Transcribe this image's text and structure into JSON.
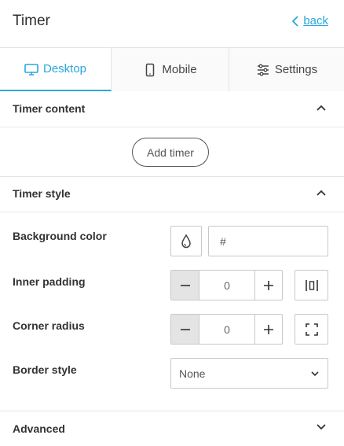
{
  "header": {
    "title": "Timer",
    "back_label": "back"
  },
  "tabs": [
    {
      "label": "Desktop",
      "icon": "desktop-icon",
      "active": true
    },
    {
      "label": "Mobile",
      "icon": "mobile-icon",
      "active": false
    },
    {
      "label": "Settings",
      "icon": "sliders-icon",
      "active": false
    }
  ],
  "timer_content": {
    "label": "Timer content",
    "add_button": "Add timer"
  },
  "timer_style": {
    "label": "Timer style",
    "background_color": {
      "label": "Background color",
      "placeholder": "#",
      "icon": "droplet-icon"
    },
    "inner_padding": {
      "label": "Inner padding",
      "value": "0",
      "minus": "−",
      "plus": "+",
      "icon": "padding-icon"
    },
    "corner_radius": {
      "label": "Corner radius",
      "value": "0",
      "minus": "−",
      "plus": "+",
      "icon": "corners-icon"
    },
    "border_style": {
      "label": "Border style",
      "value": "None"
    }
  },
  "advanced": {
    "label": "Advanced"
  },
  "colors": {
    "accent": "#2aa6dd",
    "border": "#c8c8c8",
    "stepper_bg": "#e4e4e4"
  }
}
